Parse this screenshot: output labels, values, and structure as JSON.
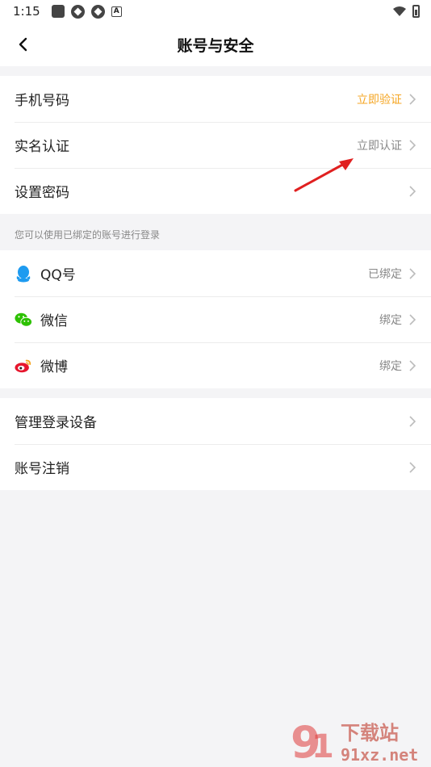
{
  "status": {
    "time": "1:15"
  },
  "header": {
    "title": "账号与安全"
  },
  "group1": [
    {
      "label": "手机号码",
      "value": "立即验证"
    },
    {
      "label": "实名认证",
      "value": "立即认证"
    },
    {
      "label": "设置密码",
      "value": ""
    }
  ],
  "hint": "您可以使用已绑定的账号进行登录",
  "group2": [
    {
      "label": "QQ号",
      "value": "已绑定",
      "icon": "qq-icon"
    },
    {
      "label": "微信",
      "value": "绑定",
      "icon": "wechat-icon"
    },
    {
      "label": "微博",
      "value": "绑定",
      "icon": "weibo-icon"
    }
  ],
  "group3": [
    {
      "label": "管理登录设备"
    },
    {
      "label": "账号注销"
    }
  ],
  "colors": {
    "accent": "#f5a623",
    "annotation_arrow": "#e02020"
  },
  "watermark": {
    "line1": "下载站",
    "line2": "91xz.net"
  }
}
